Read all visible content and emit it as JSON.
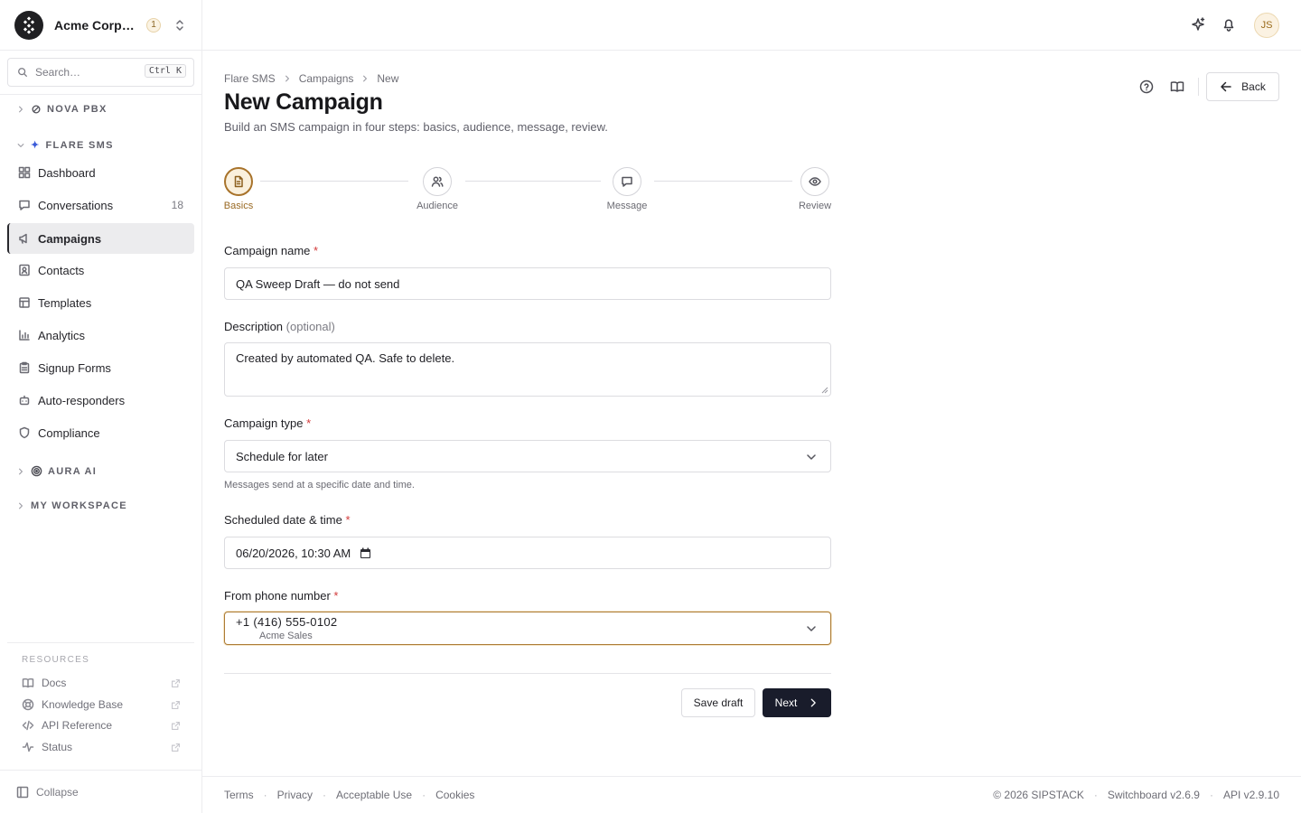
{
  "org": {
    "name": "Acme Corporation",
    "badge": "1"
  },
  "search": {
    "label": "Search…",
    "shortcut": "Ctrl K"
  },
  "sidebar": {
    "groups": {
      "nova": "NOVA PBX",
      "flare": "FLARE SMS",
      "aura": "AURA AI",
      "workspace": "MY WORKSPACE"
    },
    "items": [
      {
        "label": "Dashboard",
        "icon": "grid-icon"
      },
      {
        "label": "Conversations",
        "icon": "chat-icon",
        "count": "18"
      },
      {
        "label": "Campaigns",
        "icon": "megaphone-icon",
        "active": true
      },
      {
        "label": "Contacts",
        "icon": "contact-icon"
      },
      {
        "label": "Templates",
        "icon": "template-icon"
      },
      {
        "label": "Analytics",
        "icon": "chart-icon"
      },
      {
        "label": "Signup Forms",
        "icon": "clipboard-icon"
      },
      {
        "label": "Auto-responders",
        "icon": "bot-icon"
      },
      {
        "label": "Compliance",
        "icon": "shield-icon"
      }
    ],
    "resources_title": "RESOURCES",
    "resources": [
      {
        "label": "Docs",
        "icon": "book-icon"
      },
      {
        "label": "Knowledge Base",
        "icon": "lifebuoy-icon"
      },
      {
        "label": "API Reference",
        "icon": "code-icon"
      },
      {
        "label": "Status",
        "icon": "activity-icon"
      }
    ],
    "collapse": "Collapse"
  },
  "user": {
    "initials": "JS"
  },
  "breadcrumb": [
    "Flare SMS",
    "Campaigns",
    "New"
  ],
  "page": {
    "title": "New Campaign",
    "subtitle": "Build an SMS campaign in four steps: basics, audience, message, review.",
    "back": "Back"
  },
  "steps": [
    {
      "label": "Basics",
      "active": true
    },
    {
      "label": "Audience"
    },
    {
      "label": "Message"
    },
    {
      "label": "Review"
    }
  ],
  "form": {
    "name_label": "Campaign name",
    "name_value": "QA Sweep Draft — do not send",
    "desc_label": "Description",
    "desc_optional": "(optional)",
    "desc_value": "Created by automated QA. Safe to delete.",
    "type_label": "Campaign type",
    "type_value": "Schedule for later",
    "type_hint": "Messages send at a specific date and time.",
    "date_label": "Scheduled date & time",
    "date_value": "06/20/2026, 10:30 AM",
    "from_label": "From phone number",
    "from_number": "+1 (416) 555-0102",
    "from_name": "Acme Sales",
    "required_mark": "*"
  },
  "actions": {
    "save_draft": "Save draft",
    "next": "Next"
  },
  "footer": {
    "links": [
      "Terms",
      "Privacy",
      "Acceptable Use",
      "Cookies"
    ],
    "copyright": "© 2026 SIPSTACK",
    "version": "Switchboard v2.6.9",
    "api": "API v2.9.10",
    "separator": "·"
  },
  "colors": {
    "accent": "#a8732b",
    "primary_button": "#191c2b",
    "required": "#d23a3a"
  }
}
